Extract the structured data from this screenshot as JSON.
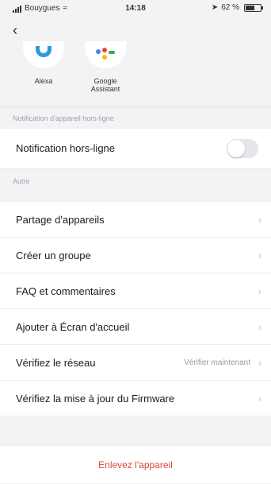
{
  "status_bar": {
    "carrier": "Bouygues",
    "time": "14:18",
    "battery": "62 %",
    "battery_level": 0.62
  },
  "nav": {
    "back_icon": "chevron-left-icon"
  },
  "assistants": [
    {
      "name": "Alexa",
      "icon": "alexa-icon"
    },
    {
      "name": "Google\nAssistant",
      "icon": "google-assistant-icon"
    }
  ],
  "sections": {
    "offline_header": "Notification d'appareil hors-ligne",
    "other_header": "Autre"
  },
  "offline_notification": {
    "label": "Notification hors-ligne",
    "enabled": false
  },
  "menu_items": [
    {
      "label": "Partage d'appareils"
    },
    {
      "label": "Créer un groupe"
    },
    {
      "label": "FAQ et commentaires"
    },
    {
      "label": "Ajouter à Écran d'accueil"
    },
    {
      "label": "Vérifiez le réseau",
      "value": "Vérifier maintenant"
    },
    {
      "label": "Vérifiez la mise à jour du Firmware"
    }
  ],
  "remove_device": {
    "label": "Enlevez l'appareil"
  },
  "colors": {
    "danger": "#e0463c",
    "alexa": "#2f9ad9",
    "toggle_off": "#e6e6ea"
  }
}
